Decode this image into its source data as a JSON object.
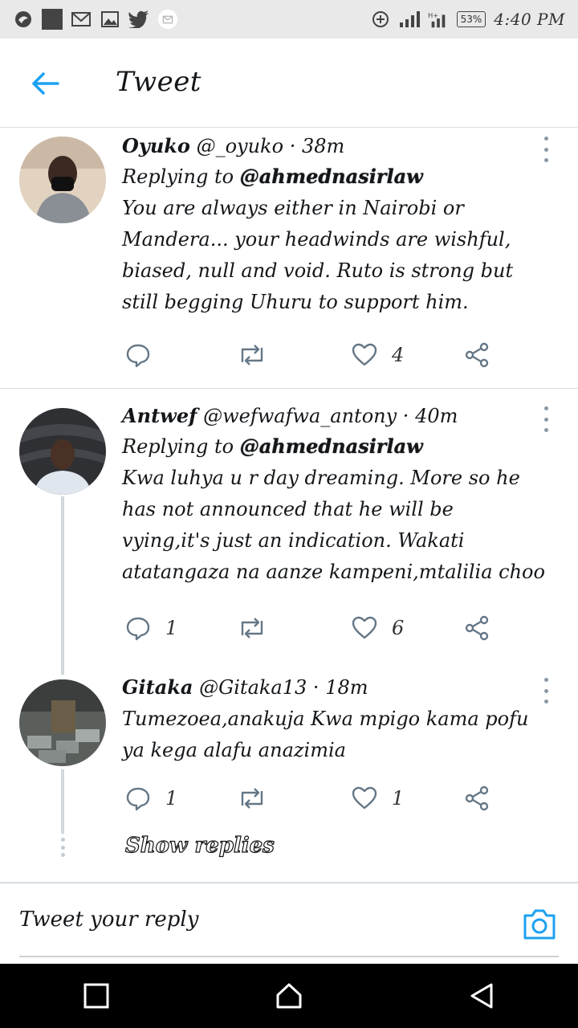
{
  "status_bar": {
    "battery": "53%",
    "time": "4:40 PM"
  },
  "header": {
    "title": "Tweet"
  },
  "tweets": [
    {
      "name": "Oyuko",
      "handle": "@_oyuko",
      "time": "38m",
      "replying_prefix": "Replying to",
      "replying_to": "@ahmednasirlaw",
      "text": "You are always either in Nairobi or Mandera... your headwinds are wishful, biased, null and void. Ruto is strong but still begging Uhuru to support him.",
      "reply_count": "",
      "like_count": "4"
    },
    {
      "name": "Antwef",
      "handle": "@wefwafwa_antony",
      "time": "40m",
      "replying_prefix": "Replying to",
      "replying_to": "@ahmednasirlaw",
      "text": "Kwa luhya u r day dreaming. More so he has not announced that he will be vying,it's just an indication. Wakati atatangaza na aanze kampeni,mtalilia choo",
      "reply_count": "1",
      "like_count": "6"
    },
    {
      "name": "Gitaka",
      "handle": "@Gitaka13",
      "time": "18m",
      "text": "Tumezoea,anakuja Kwa mpigo kama pofu ya kega alafu anazimia",
      "reply_count": "1",
      "like_count": "1"
    }
  ],
  "show_replies": "Show replies",
  "reply_bar": {
    "placeholder": "Tweet your reply"
  },
  "colors": {
    "accent": "#1da1f2",
    "icon_gray": "#657786",
    "divider": "#d6dde3"
  }
}
